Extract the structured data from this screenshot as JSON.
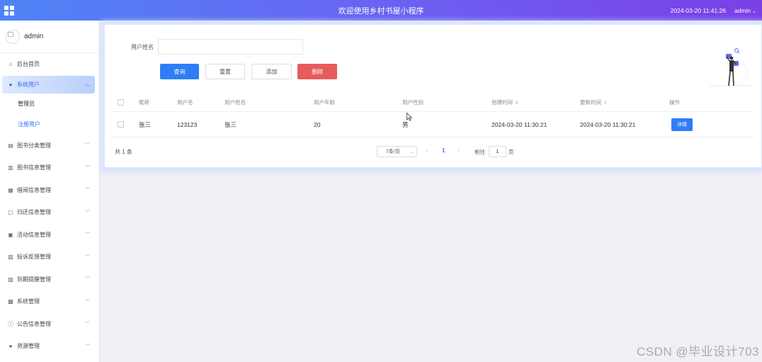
{
  "topbar": {
    "title": "欢迎使用乡村书屋小程序",
    "datetime": "2024-03-20 11:41:26",
    "user": "admin"
  },
  "sidebar": {
    "username": "admin",
    "items": [
      {
        "label": "后台首页",
        "icon": "home-icon"
      },
      {
        "label": "系统用户",
        "icon": "user-icon",
        "expanded": true,
        "children": [
          {
            "label": "管理员"
          },
          {
            "label": "注册用户"
          }
        ]
      },
      {
        "label": "图书分类管理",
        "icon": "category-icon"
      },
      {
        "label": "图书信息管理",
        "icon": "book-icon"
      },
      {
        "label": "借阅信息管理",
        "icon": "borrow-icon"
      },
      {
        "label": "归还信息管理",
        "icon": "return-icon"
      },
      {
        "label": "活动信息管理",
        "icon": "activity-icon"
      },
      {
        "label": "投诉反馈管理",
        "icon": "feedback-icon"
      },
      {
        "label": "到期提醒管理",
        "icon": "reminder-icon"
      },
      {
        "label": "系统管理",
        "icon": "settings-icon"
      },
      {
        "label": "公告信息管理",
        "icon": "notice-icon"
      },
      {
        "label": "资源管理",
        "icon": "resource-icon"
      }
    ]
  },
  "search": {
    "label": "用户姓名",
    "value": "",
    "placeholder": ""
  },
  "buttons": {
    "query": "查询",
    "reset": "重置",
    "add": "添加",
    "delete": "删除"
  },
  "table": {
    "columns": [
      "昵称",
      "用户名",
      "用户姓名",
      "用户年龄",
      "用户性别",
      "创建时间",
      "更新时间",
      "操作"
    ],
    "rows": [
      {
        "nickname": "张三",
        "username": "123123",
        "fullname": "张三",
        "age": "20",
        "gender": "男",
        "created": "2024-03-20 11:30:21",
        "updated": "2024-03-20 11:30:21",
        "action": "详情"
      }
    ]
  },
  "pagination": {
    "total": "共 1 条",
    "page_size": "7条/页",
    "current_page": "1",
    "goto_label": "前往",
    "goto_value": "1",
    "page_unit": "页"
  },
  "watermark": "CSDN @毕业设计703",
  "colors": {
    "primary": "#2f7df5",
    "danger": "#e85b5b",
    "header_start": "#4f84f6",
    "header_end": "#7b3fe6"
  }
}
